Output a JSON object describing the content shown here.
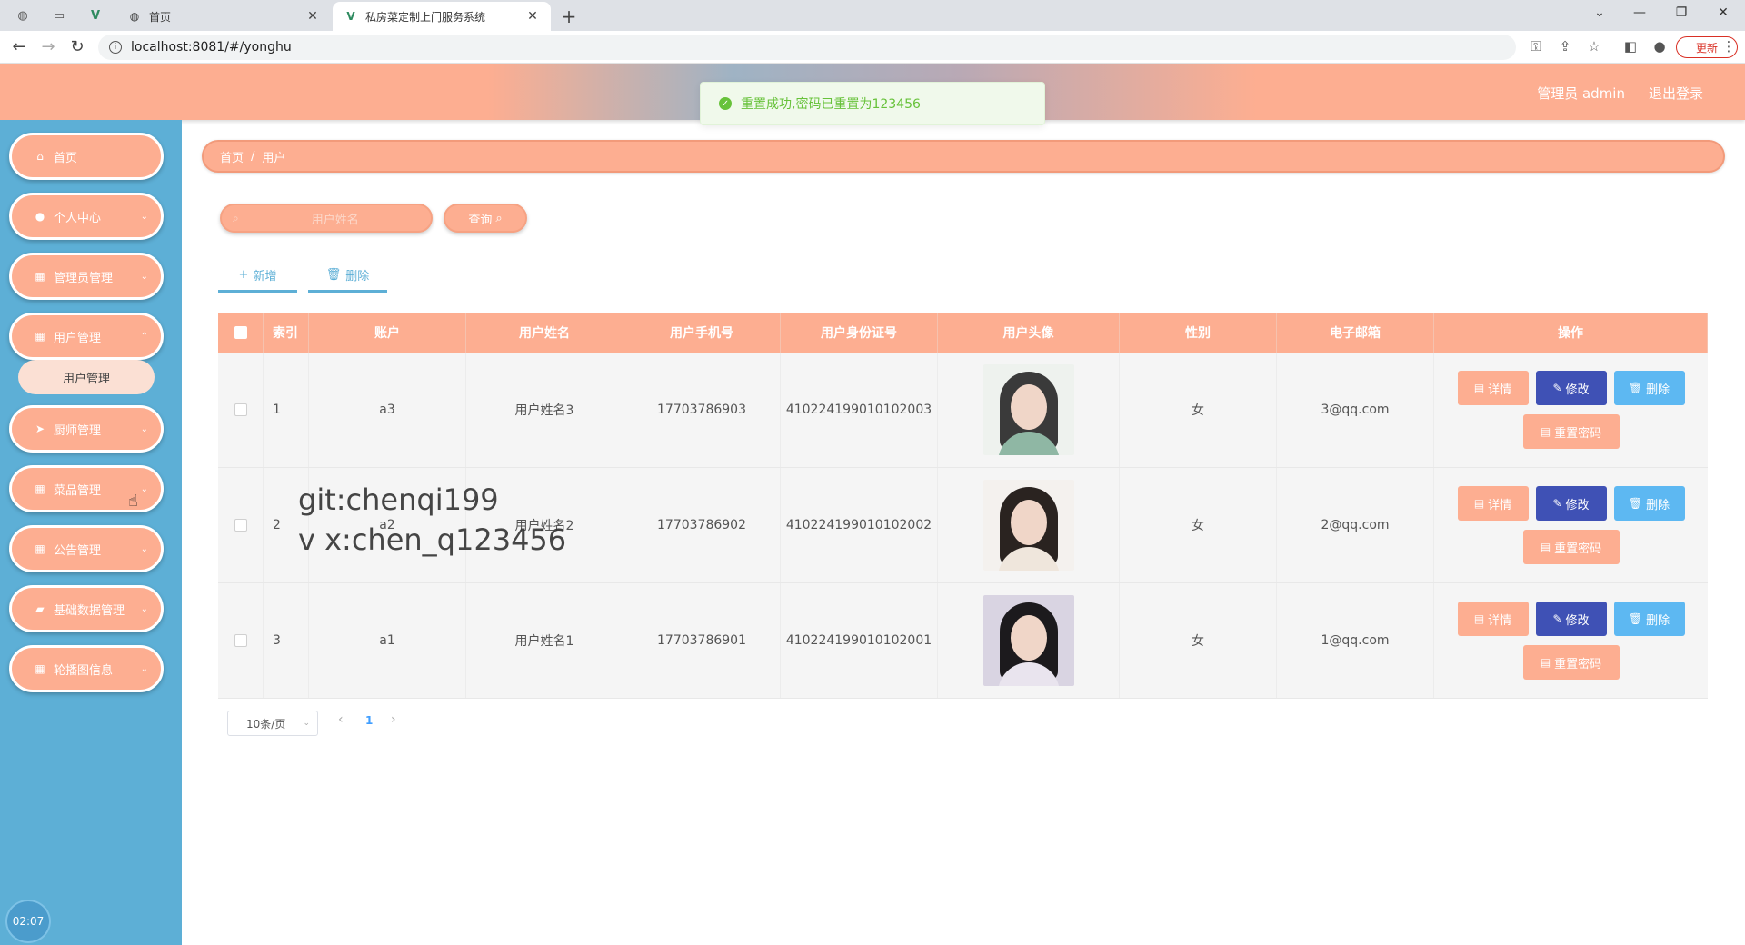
{
  "browser": {
    "tab_inactive_title": "首页",
    "tab_active_title": "私房菜定制上门服务系统",
    "url": "localhost:8081/#/yonghu",
    "update_label": "更新",
    "icons": {
      "favicon_inactive": "globe-icon",
      "favicon_active": "vue-logo-icon"
    }
  },
  "header": {
    "user_label": "管理员 admin",
    "logout_label": "退出登录",
    "toast_message": "重置成功,密码已重置为123456"
  },
  "sidebar": {
    "items": [
      {
        "label": "首页",
        "icon": "home-icon"
      },
      {
        "label": "个人中心",
        "icon": "user-icon"
      },
      {
        "label": "管理员管理",
        "icon": "grid-icon"
      },
      {
        "label": "用户管理",
        "icon": "grid-icon"
      },
      {
        "label": "厨师管理",
        "icon": "send-icon"
      },
      {
        "label": "菜品管理",
        "icon": "grid-icon"
      },
      {
        "label": "公告管理",
        "icon": "grid-icon"
      },
      {
        "label": "基础数据管理",
        "icon": "folder-icon"
      },
      {
        "label": "轮播图信息",
        "icon": "grid-icon"
      }
    ],
    "submenu_label": "用户管理",
    "clock": "02:07"
  },
  "breadcrumb": {
    "home": "首页",
    "separator": "/",
    "current": "用户"
  },
  "search": {
    "placeholder": "用户姓名",
    "query_label": "查询"
  },
  "actions": {
    "add_label": "新增",
    "delete_label": "删除"
  },
  "table": {
    "headers": [
      "索引",
      "账户",
      "用户姓名",
      "用户手机号",
      "用户身份证号",
      "用户头像",
      "性别",
      "电子邮箱",
      "操作"
    ],
    "rows": [
      {
        "index": "1",
        "account": "a3",
        "name": "用户姓名3",
        "phone": "17703786903",
        "id_card": "410224199010102003",
        "gender": "女",
        "email": "3@qq.com"
      },
      {
        "index": "2",
        "account": "a2",
        "name": "用户姓名2",
        "phone": "17703786902",
        "id_card": "410224199010102002",
        "gender": "女",
        "email": "2@qq.com"
      },
      {
        "index": "3",
        "account": "a1",
        "name": "用户姓名1",
        "phone": "17703786901",
        "id_card": "410224199010102001",
        "gender": "女",
        "email": "1@qq.com"
      }
    ],
    "op_labels": {
      "detail": "详情",
      "edit": "修改",
      "delete": "删除",
      "reset": "重置密码"
    }
  },
  "pagination": {
    "page_size": "10条/页",
    "current_page": "1"
  },
  "watermark": {
    "line1": "git:chenqi199",
    "line2": "v x:chen_q123456"
  },
  "colors": {
    "accent": "#fdae91",
    "sidebar": "#5dafd6",
    "edit_button": "#3f51b5",
    "delete_button": "#5db8f2"
  }
}
